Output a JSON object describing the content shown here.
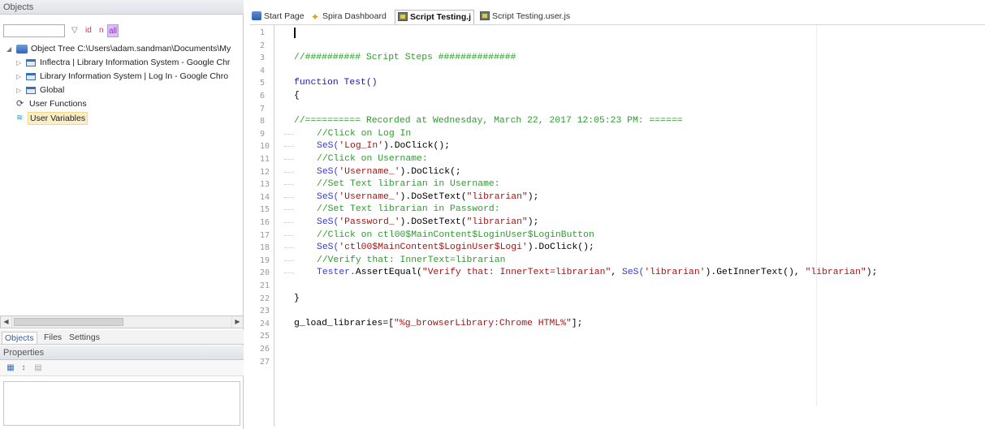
{
  "left": {
    "objects_header": "Objects",
    "filter": {
      "value": "",
      "id_tool": "id",
      "n_tool": "n",
      "all_tool": "all"
    },
    "tree": [
      {
        "label": "Object Tree C:\\Users\\adam.sandman\\Documents\\My",
        "level": 0,
        "expanded": true,
        "icon": "object-tree-icon"
      },
      {
        "label": "Inflectra | Library Information System - Google Chr",
        "level": 1,
        "expanded": false,
        "icon": "window-icon"
      },
      {
        "label": "Library Information System | Log In - Google Chro",
        "level": 1,
        "expanded": false,
        "icon": "window-icon"
      },
      {
        "label": "Global",
        "level": 1,
        "expanded": false,
        "icon": "window-icon"
      },
      {
        "label": "User Functions",
        "level": 0,
        "icon": "user-functions-icon"
      },
      {
        "label": "User Variables",
        "level": 0,
        "icon": "user-variables-icon",
        "selected": true
      }
    ],
    "bottom_tabs": [
      "Objects",
      "Files",
      "Settings"
    ],
    "properties_header": "Properties"
  },
  "editor": {
    "tabs": [
      {
        "label": "Start Page",
        "icon": "start-page-icon"
      },
      {
        "label": "Spira Dashboard",
        "icon": "spira-icon"
      },
      {
        "label": "Script Testing.j",
        "icon": "script-icon",
        "active": true
      },
      {
        "label": "Script Testing.user.js",
        "icon": "script-icon"
      }
    ],
    "line_numbers": [
      "1",
      "2",
      "3",
      "4",
      "5",
      "6",
      "7",
      "8",
      "9",
      "10",
      "11",
      "12",
      "13",
      "14",
      "15",
      "16",
      "17",
      "18",
      "19",
      "20",
      "21",
      "22",
      "23",
      "24",
      "25",
      "26",
      "27"
    ],
    "code": [
      {
        "n": 1,
        "segs": []
      },
      {
        "n": 2,
        "segs": []
      },
      {
        "n": 3,
        "segs": [
          {
            "t": "//########## Script Steps ##############",
            "c": "cm"
          }
        ]
      },
      {
        "n": 4,
        "segs": []
      },
      {
        "n": 5,
        "segs": [
          {
            "t": "function Test()",
            "c": "kw"
          }
        ]
      },
      {
        "n": 6,
        "segs": [
          {
            "t": "{",
            "c": "plain"
          }
        ]
      },
      {
        "n": 7,
        "segs": []
      },
      {
        "n": 8,
        "segs": [
          {
            "t": "//========== Recorded at Wednesday, March 22, 2017 12:05:23 PM: ======",
            "c": "cm"
          }
        ]
      },
      {
        "n": 9,
        "indent": true,
        "segs": [
          {
            "t": "//Click on Log In",
            "c": "cm"
          }
        ]
      },
      {
        "n": 10,
        "indent": true,
        "segs": [
          {
            "t": "SeS(",
            "c": "fn"
          },
          {
            "t": "'Log_In'",
            "c": "str"
          },
          {
            "t": ").DoClick();",
            "c": "plain"
          }
        ]
      },
      {
        "n": 11,
        "indent": true,
        "segs": [
          {
            "t": "//Click on Username:",
            "c": "cm"
          }
        ]
      },
      {
        "n": 12,
        "indent": true,
        "segs": [
          {
            "t": "SeS(",
            "c": "fn"
          },
          {
            "t": "'Username_'",
            "c": "str"
          },
          {
            "t": ").DoClick(;",
            "c": "plain"
          }
        ]
      },
      {
        "n": 13,
        "indent": true,
        "segs": [
          {
            "t": "//Set Text librarian in Username:",
            "c": "cm"
          }
        ]
      },
      {
        "n": 14,
        "indent": true,
        "segs": [
          {
            "t": "SeS(",
            "c": "fn"
          },
          {
            "t": "'Username_'",
            "c": "str"
          },
          {
            "t": ").DoSetText(",
            "c": "plain"
          },
          {
            "t": "\"librarian\"",
            "c": "str"
          },
          {
            "t": ");",
            "c": "plain"
          }
        ]
      },
      {
        "n": 15,
        "indent": true,
        "segs": [
          {
            "t": "//Set Text librarian in Password:",
            "c": "cm"
          }
        ]
      },
      {
        "n": 16,
        "indent": true,
        "segs": [
          {
            "t": "SeS(",
            "c": "fn"
          },
          {
            "t": "'Password_'",
            "c": "str"
          },
          {
            "t": ").DoSetText(",
            "c": "plain"
          },
          {
            "t": "\"librarian\"",
            "c": "str"
          },
          {
            "t": ");",
            "c": "plain"
          }
        ]
      },
      {
        "n": 17,
        "indent": true,
        "segs": [
          {
            "t": "//Click on ctl00$MainContent$LoginUser$LoginButton",
            "c": "cm"
          }
        ]
      },
      {
        "n": 18,
        "indent": true,
        "segs": [
          {
            "t": "SeS(",
            "c": "fn"
          },
          {
            "t": "'ctl00$MainContent$LoginUser$Logi'",
            "c": "str"
          },
          {
            "t": ").DoClick();",
            "c": "plain"
          }
        ]
      },
      {
        "n": 19,
        "indent": true,
        "segs": [
          {
            "t": "//Verify that: InnerText=librarian",
            "c": "cm"
          }
        ]
      },
      {
        "n": 20,
        "indent": true,
        "segs": [
          {
            "t": "Tester.",
            "c": "fn"
          },
          {
            "t": "AssertEqual(",
            "c": "plain"
          },
          {
            "t": "\"Verify that: InnerText=librarian\"",
            "c": "str"
          },
          {
            "t": ", ",
            "c": "plain"
          },
          {
            "t": "SeS(",
            "c": "fn"
          },
          {
            "t": "'librarian'",
            "c": "str"
          },
          {
            "t": ").GetInnerText(), ",
            "c": "plain"
          },
          {
            "t": "\"librarian\"",
            "c": "str"
          },
          {
            "t": ");",
            "c": "plain"
          }
        ]
      },
      {
        "n": 21,
        "segs": []
      },
      {
        "n": 22,
        "segs": [
          {
            "t": "}",
            "c": "plain"
          }
        ]
      },
      {
        "n": 23,
        "segs": []
      },
      {
        "n": 24,
        "segs": [
          {
            "t": "g_load_libraries=[",
            "c": "plain"
          },
          {
            "t": "\"%g_browserLibrary:Chrome HTML%\"",
            "c": "str"
          },
          {
            "t": "];",
            "c": "plain"
          }
        ]
      },
      {
        "n": 25,
        "segs": []
      },
      {
        "n": 26,
        "segs": []
      },
      {
        "n": 27,
        "segs": []
      }
    ]
  },
  "colors": {
    "comment": "#2f9b2f",
    "keyword": "#1a1aa6",
    "string": "#a31515",
    "selection": "#fbeec6"
  }
}
